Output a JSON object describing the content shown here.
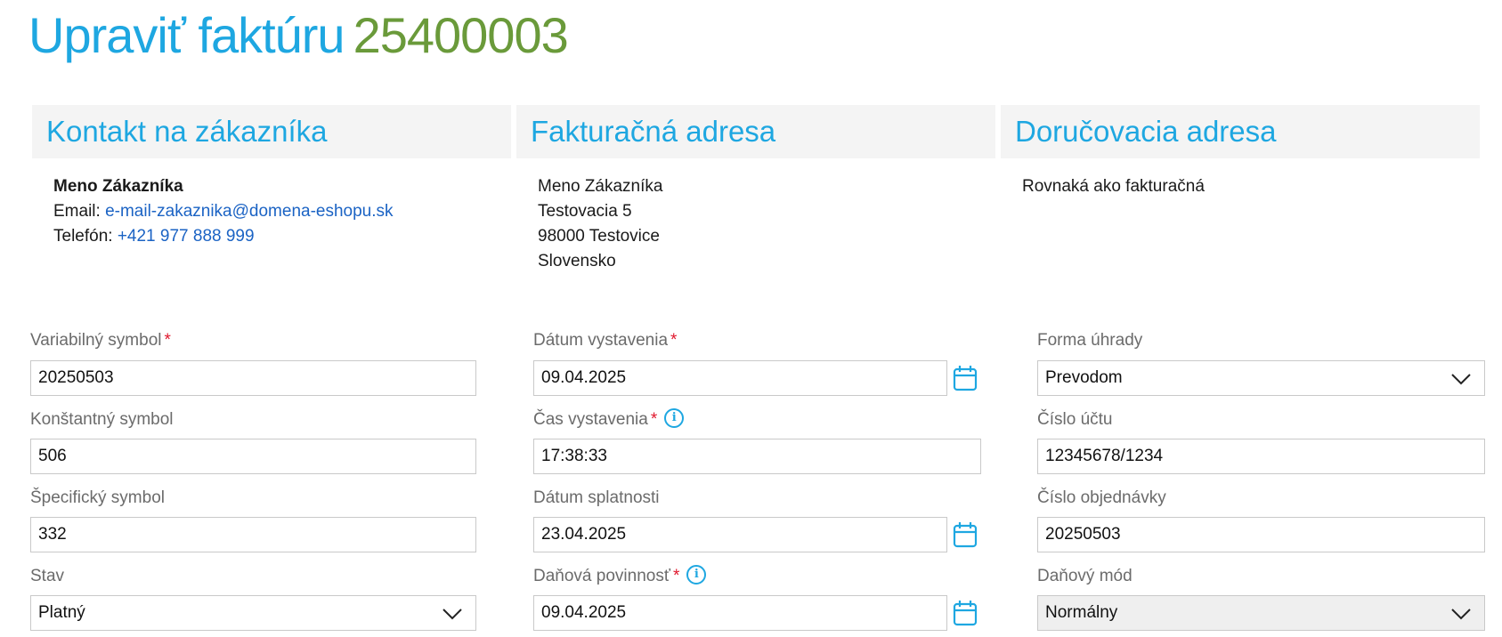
{
  "header": {
    "title_prefix": "Upraviť faktúru",
    "invoice_number": "25400003"
  },
  "panels": {
    "contact": {
      "heading": "Kontakt na zákazníka",
      "name": "Meno Zákazníka",
      "email_label": "Email:",
      "email": "e-mail-zakaznika@domena-eshopu.sk",
      "phone_label": "Telefón:",
      "phone": "+421 977 888 999"
    },
    "billing": {
      "heading": "Fakturačná adresa",
      "lines": [
        "Meno Zákazníka",
        "Testovacia 5",
        "98000 Testovice",
        "Slovensko"
      ]
    },
    "delivery": {
      "heading": "Doručovacia adresa",
      "text": "Rovnaká ako fakturačná"
    }
  },
  "form": {
    "variable_symbol": {
      "label": "Variabilný symbol",
      "required": "*",
      "value": "20250503"
    },
    "constant_symbol": {
      "label": "Konštantný symbol",
      "value": "506"
    },
    "specific_symbol": {
      "label": "Špecifický symbol",
      "value": "332"
    },
    "status": {
      "label": "Stav",
      "value": "Platný"
    },
    "issue_date": {
      "label": "Dátum vystavenia",
      "required": "*",
      "value": "09.04.2025"
    },
    "issue_time": {
      "label": "Čas vystavenia",
      "required": "*",
      "value": "17:38:33"
    },
    "due_date": {
      "label": "Dátum splatnosti",
      "value": "23.04.2025"
    },
    "tax_date": {
      "label": "Daňová povinnosť",
      "required": "*",
      "value": "09.04.2025"
    },
    "payment_method": {
      "label": "Forma úhrady",
      "value": "Prevodom"
    },
    "account_number": {
      "label": "Číslo účtu",
      "value": "12345678/1234"
    },
    "order_number": {
      "label": "Číslo objednávky",
      "value": "20250503"
    },
    "tax_mode": {
      "label": "Daňový mód",
      "value": "Normálny"
    }
  },
  "colors": {
    "accent": "#1ea7e1",
    "invoice_number": "#6a9a3a",
    "required": "#e0182d",
    "link": "#1b63c4"
  },
  "icons": {
    "calendar": "calendar-icon",
    "info": "info-icon",
    "dropdown": "chevron-down-icon"
  }
}
